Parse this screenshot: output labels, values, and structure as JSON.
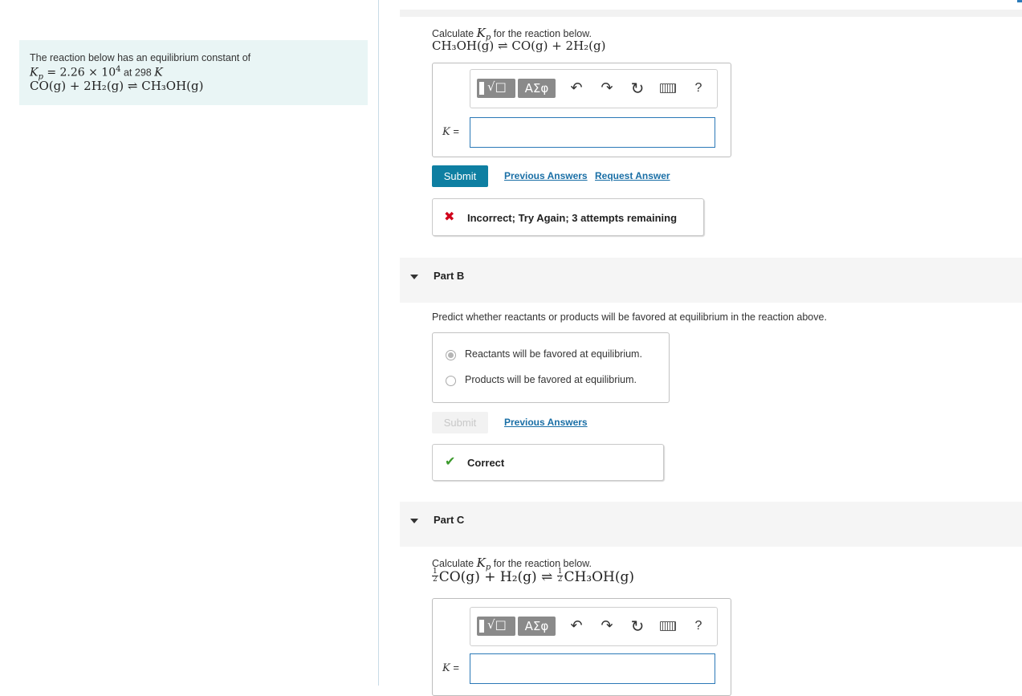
{
  "intro": {
    "line1": "The reaction below has an equilibrium constant of",
    "kp_prefix": "K",
    "kp_sub": "p",
    "kp_eq": " = 2.26 × 10",
    "kp_exp": "4",
    "kp_temp_text": " at 298 ",
    "kp_temp_unit": "K",
    "reaction": "CO(g) + 2H₂(g) ⇌ CH₃OH(g)"
  },
  "part_a": {
    "prompt_prefix": "Calculate ",
    "prompt_k": "K",
    "prompt_sub": "p",
    "prompt_suffix": " for the reaction below.",
    "reaction": "CH₃OH(g) ⇌ CO(g) + 2H₂(g)",
    "toolbar": {
      "template_glyph": "√□",
      "greek_label": "ΑΣφ",
      "undo_glyph": "↶",
      "redo_glyph": "↷",
      "reset_glyph": "↻",
      "help_label": "?"
    },
    "k_label_var": "K",
    "k_label_eq": " =",
    "k_value": "",
    "submit_label": "Submit",
    "previous_answers": "Previous Answers",
    "request_answer": "Request Answer",
    "feedback_icon": "✖",
    "feedback": "Incorrect; Try Again; 3 attempts remaining"
  },
  "part_b": {
    "title": "Part B",
    "prompt": "Predict whether reactants or products will be favored at equilibrium in the reaction above.",
    "options": [
      {
        "label": "Reactants will be favored at equilibrium.",
        "selected": true
      },
      {
        "label": "Products will be favored at equilibrium.",
        "selected": false
      }
    ],
    "submit_label": "Submit",
    "previous_answers": "Previous Answers",
    "feedback_icon": "✔",
    "feedback": "Correct"
  },
  "part_c": {
    "title": "Part C",
    "prompt_prefix": "Calculate ",
    "prompt_k": "K",
    "prompt_sub": "p",
    "prompt_suffix": " for the reaction below.",
    "frac_num": "1",
    "frac_den": "2",
    "reaction_part1": "CO(g) + H₂(g) ⇌ ",
    "reaction_part2": "CH₃OH(g)",
    "toolbar": {
      "template_glyph": "√□",
      "greek_label": "ΑΣφ",
      "undo_glyph": "↶",
      "redo_glyph": "↷",
      "reset_glyph": "↻",
      "help_label": "?"
    },
    "k_label_var": "K",
    "k_label_eq": " =",
    "k_value": ""
  },
  "colors": {
    "intro_bg": "#e9f5f5",
    "submit_bg": "#0e7fa2",
    "link": "#1a6fa6",
    "incorrect": "#d0021b",
    "correct": "#3c9a2c",
    "input_border": "#2b79b7"
  }
}
